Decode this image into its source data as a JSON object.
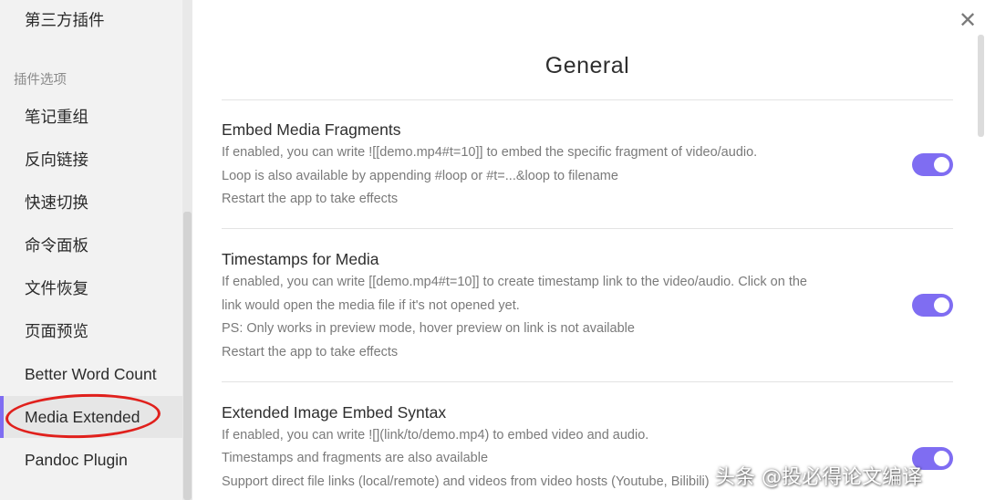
{
  "sidebar": {
    "top_item": "第三方插件",
    "heading": "插件选项",
    "items": [
      {
        "label": "笔记重组"
      },
      {
        "label": "反向链接"
      },
      {
        "label": "快速切换"
      },
      {
        "label": "命令面板"
      },
      {
        "label": "文件恢复"
      },
      {
        "label": "页面预览"
      },
      {
        "label": "Better Word Count"
      },
      {
        "label": "Media Extended"
      },
      {
        "label": "Pandoc Plugin"
      }
    ],
    "active_item": "Media Extended"
  },
  "main": {
    "title": "General",
    "close_icon": "close-icon",
    "settings": [
      {
        "name": "Embed Media Fragments",
        "desc": [
          "If enabled, you can write ![[demo.mp4#t=10]] to embed the specific fragment of video/audio.",
          "Loop is also available by appending #loop or #t=...&loop to filename",
          "Restart the app to take effects"
        ],
        "enabled": true
      },
      {
        "name": "Timestamps for Media",
        "desc": [
          "If enabled, you can write [[demo.mp4#t=10]] to create timestamp link to the video/audio. Click on the",
          "link would open the media file if it's not opened yet.",
          "PS: Only works in preview mode, hover preview on link is not available",
          "Restart the app to take effects"
        ],
        "enabled": true
      },
      {
        "name": "Extended Image Embed Syntax",
        "desc": [
          "If enabled, you can write ![](link/to/demo.mp4) to embed video and audio.",
          "Timestamps and fragments are also available",
          "Support direct file links (local/remote) and videos from video hosts (Youtube, Bilibili)"
        ],
        "enabled": true
      }
    ]
  },
  "watermark": "头条 @投必得论文编译",
  "colors": {
    "accent": "#7f6df2",
    "annotation": "#e0201c"
  }
}
